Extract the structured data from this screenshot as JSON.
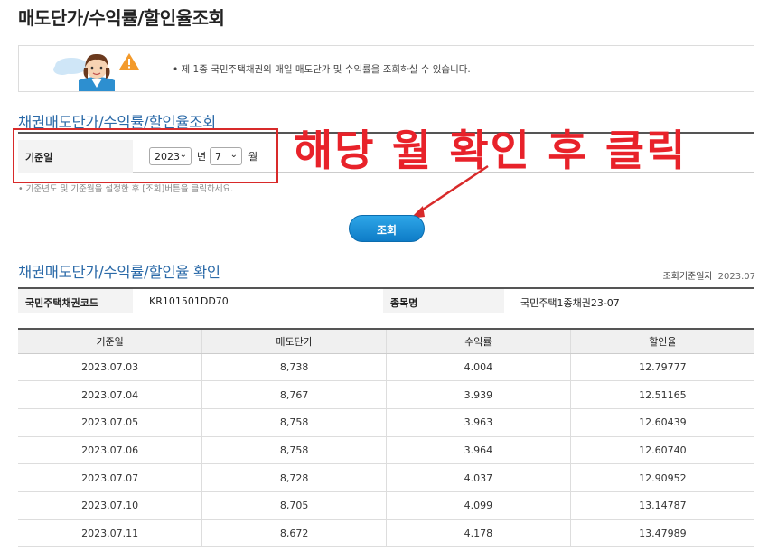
{
  "page_title": "매도단가/수익률/할인율조회",
  "notice": {
    "text": "• 제 1종 국민주택채권의 매일 매도단가 및 수익률을 조회하실 수 있습니다."
  },
  "search": {
    "section_title": "채권매도단가/수익률/할인율조회",
    "label": "기준일",
    "year_value": "2023",
    "year_unit": "년",
    "month_value": "7",
    "month_unit": "월",
    "help_text": "• 기준년도 및 기준월을 설정한 후 [조회]버튼을 클릭하세요.",
    "button_label": "조회"
  },
  "annotation": {
    "text": "해당 월 확인 후 클릭",
    "color": "#e8222a"
  },
  "result": {
    "section_title": "채권매도단가/수익률/할인율 확인",
    "ref_date_label": "조회기준일자",
    "ref_date_value": "2023.07",
    "code_label": "국민주택채권코드",
    "code_value": "KR101501DD70",
    "item_label": "종목명",
    "item_value": "국민주택1종채권23-07"
  },
  "table": {
    "headers": [
      "기준일",
      "매도단가",
      "수익률",
      "할인율"
    ],
    "rows": [
      [
        "2023.07.03",
        "8,738",
        "4.004",
        "12.79777"
      ],
      [
        "2023.07.04",
        "8,767",
        "3.939",
        "12.51165"
      ],
      [
        "2023.07.05",
        "8,758",
        "3.963",
        "12.60439"
      ],
      [
        "2023.07.06",
        "8,758",
        "3.964",
        "12.60740"
      ],
      [
        "2023.07.07",
        "8,728",
        "4.037",
        "12.90952"
      ],
      [
        "2023.07.10",
        "8,705",
        "4.099",
        "13.14787"
      ],
      [
        "2023.07.11",
        "8,672",
        "4.178",
        "13.47989"
      ]
    ]
  },
  "icons": {
    "illustration": "woman-with-warning-illustration",
    "arrow": "annotation-arrow"
  },
  "colors": {
    "accent": "#2b6aa8",
    "button": "#1a8fd6",
    "annotation_red": "#e8222a"
  }
}
